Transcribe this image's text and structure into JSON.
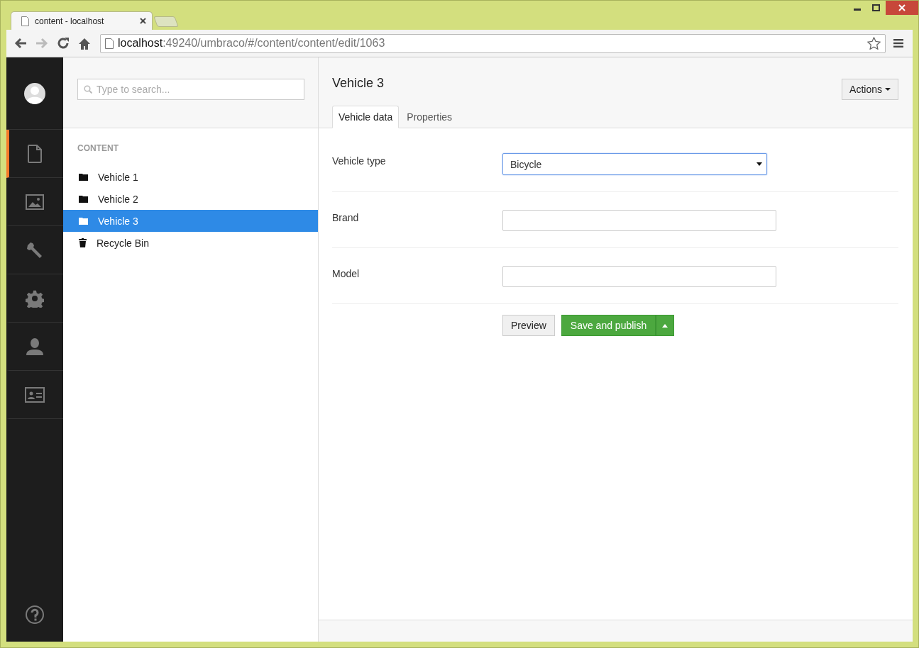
{
  "browser": {
    "tab_title": "content - localhost",
    "url_host": "localhost",
    "url_path": ":49240/umbraco/#/content/content/edit/1063"
  },
  "sections": [
    {
      "selected": true
    },
    {
      "selected": false
    },
    {
      "selected": false
    },
    {
      "selected": false
    },
    {
      "selected": false
    },
    {
      "selected": false
    }
  ],
  "search": {
    "placeholder": "Type to search..."
  },
  "tree": {
    "heading": "CONTENT",
    "items": [
      {
        "label": "Vehicle 1",
        "kind": "folder",
        "selected": false
      },
      {
        "label": "Vehicle 2",
        "kind": "folder",
        "selected": false
      },
      {
        "label": "Vehicle 3",
        "kind": "folder",
        "selected": true
      },
      {
        "label": "Recycle Bin",
        "kind": "bin",
        "selected": false
      }
    ]
  },
  "editor": {
    "title": "Vehicle 3",
    "actions": "Actions",
    "tabs": [
      {
        "label": "Vehicle data",
        "selected": true
      },
      {
        "label": "Properties",
        "selected": false
      }
    ],
    "fields": [
      {
        "label": "Vehicle type",
        "kind": "select",
        "value": "Bicycle",
        "focused": true
      },
      {
        "label": "Brand",
        "kind": "text",
        "focused": false
      },
      {
        "label": "Model",
        "kind": "text",
        "focused": false
      }
    ],
    "buttons": {
      "preview": "Preview",
      "publish": "Save and publish"
    }
  }
}
